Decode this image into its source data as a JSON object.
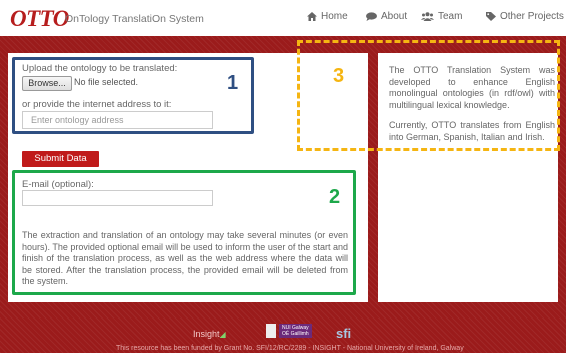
{
  "header": {
    "logo": "OTTO",
    "tagline": "OnTology TranslatiOn System",
    "nav": [
      {
        "label": "Home",
        "icon": "home-icon"
      },
      {
        "label": "About",
        "icon": "speech-bubble-icon"
      },
      {
        "label": "Team",
        "icon": "users-icon"
      },
      {
        "label": "Other Projects",
        "icon": "tag-icon"
      }
    ]
  },
  "form": {
    "upload_label": "Upload the ontology to be translated:",
    "browse_label": "Browse...",
    "no_file_text": "No file selected.",
    "address_label": "or provide the internet address to it:",
    "address_placeholder": "Enter ontology address",
    "submit_label": "Submit Data",
    "email_label": "E-mail (optional):",
    "email_value": "",
    "info_text": "The extraction and translation of an ontology may take several minutes (or even hours). The provided optional email will be used to inform the user of the start and finish of the translation process, as well as the web address where the data will be stored. After the translation process, the provided email will be deleted from the system."
  },
  "sidebar": {
    "paragraph1": "The OTTO Translation System was developed to enhance English monolingual ontologies (in rdf/owl) with multilingual lexical knowledge.",
    "paragraph2": "Currently, OTTO translates from English into German, Spanish, Italian and Irish."
  },
  "annotations": {
    "box1_number": "1",
    "box2_number": "2",
    "box3_number": "3",
    "box1_color": "#2f4f82",
    "box2_color": "#1da84a",
    "box3_color": "#f5b512"
  },
  "footer": {
    "insight": "Insight",
    "nui_galway": "NUI Galway\nOÉ Gaillimh",
    "sfi": "sfi",
    "funding_text": "This resource has been funded by Grant No. SFI/12/RC/2289 - INSIGHT - National University of Ireland, Galway"
  },
  "colors": {
    "brand_red": "#9b1b1b",
    "button_red": "#c01a1a"
  }
}
